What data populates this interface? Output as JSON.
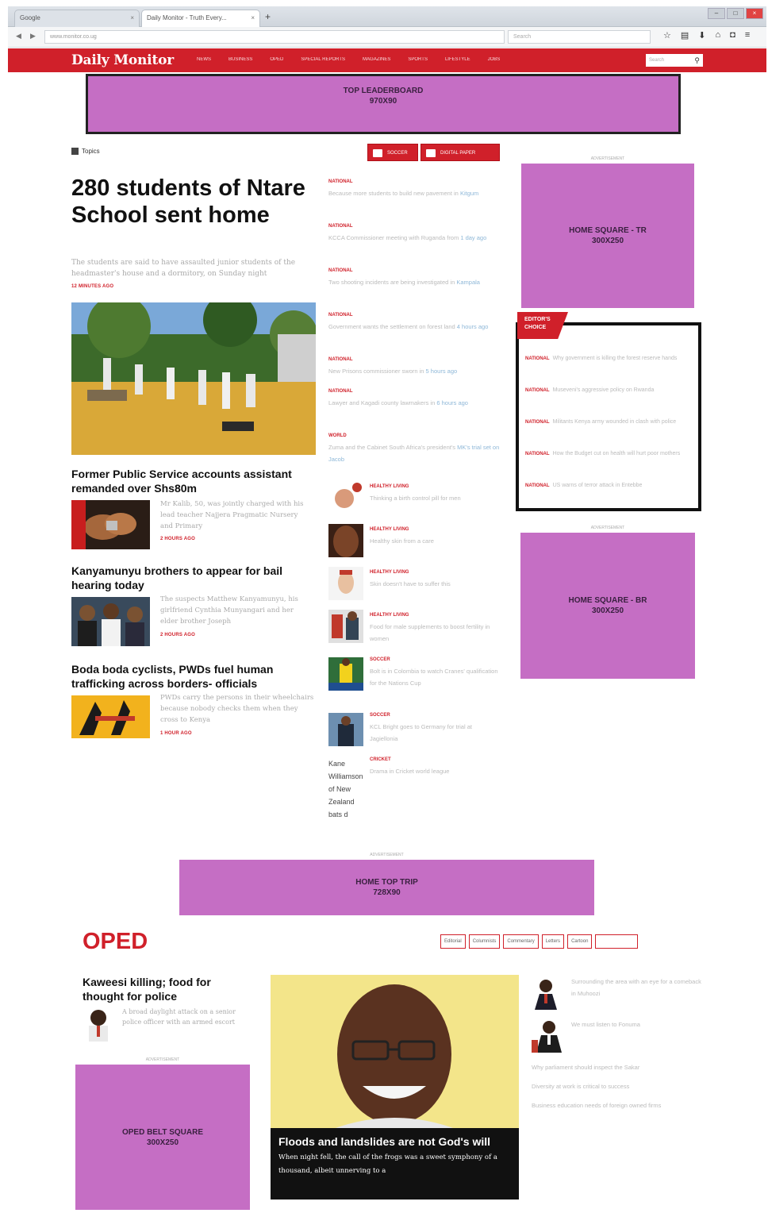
{
  "browser": {
    "tabs": [
      {
        "label": "Google"
      },
      {
        "label": "Daily Monitor - Truth Every..."
      }
    ],
    "url": "www.monitor.co.ug",
    "search_placeholder": "Search"
  },
  "site": {
    "logo": "Daily Monitor",
    "menu": [
      "NEWS",
      "BUSINESS",
      "OPED",
      "SPECIAL REPORTS",
      "MAGAZINES",
      "SPORTS",
      "LIFESTYLE",
      "JOBS"
    ],
    "search_placeholder": "Search"
  },
  "ads": {
    "leaderboard": [
      "TOP LEADERBOARD",
      "970X90"
    ],
    "tr": [
      "HOME SQUARE - TR",
      "300X250"
    ],
    "br": [
      "HOME SQUARE - BR",
      "300X250"
    ],
    "strip": [
      "HOME TOP TRIP",
      "728X90"
    ],
    "oped": [
      "OPED BELT SQUARE",
      "300X250"
    ],
    "label": "ADVERTISEMENT"
  },
  "topics": "Topics",
  "buttons": {
    "soccer": "SOCCER",
    "epaper": "DIGITAL PAPER"
  },
  "lead": {
    "title": "280 students of Ntare School sent home",
    "desc": "The students are said to have assaulted junior students of the headmaster's house and a dormitory, on Sunday night",
    "time": "12 MINUTES AGO"
  },
  "stories": [
    {
      "title": "Former Public Service accounts assistant remanded over Shs80m",
      "desc": "Mr Kalib, 50, was jointly charged with his lead teacher Najjera Pragmatic Nursery and Primary",
      "time": "2 HOURS AGO"
    },
    {
      "title": "Kanyamunyu brothers to appear for bail hearing today",
      "desc": "The suspects Matthew Kanyamunyu, his girlfriend Cynthia Munyangari and her elder brother Joseph",
      "time": "2 HOURS AGO"
    },
    {
      "title": "Boda boda cyclists, PWDs fuel human trafficking across borders- officials",
      "desc": "PWDs carry the persons in their wheelchairs because nobody checks them when they cross to Kenya",
      "time": "1 HOUR AGO"
    }
  ],
  "middle": [
    {
      "cat": "NATIONAL",
      "text": "Because more students to build new pavement in",
      "ago": "Kitgum"
    },
    {
      "cat": "NATIONAL",
      "text": "KCCA Commissioner meeting with Ruganda from",
      "ago": "1 day ago"
    },
    {
      "cat": "NATIONAL",
      "text": "Two shooting incidents are being investigated in",
      "ago": "Kampala"
    },
    {
      "cat": "NATIONAL",
      "text": "Government wants the settlement on forest land",
      "ago": "4 hours ago"
    },
    {
      "cat": "NATIONAL",
      "text": "New Prisons commissioner sworn in",
      "ago": "5 hours ago"
    },
    {
      "cat": "NATIONAL",
      "text": "Lawyer and Kagadi county lawmakers in",
      "ago": "6 hours ago"
    },
    {
      "cat": "WORLD",
      "text": "Zuma and the Cabinet South Africa's president's",
      "ago": "MK's trial set on Jacob"
    }
  ],
  "healthy": [
    {
      "cat": "HEALTHY LIVING",
      "text": "Thinking a birth control pill for men"
    },
    {
      "cat": "HEALTHY LIVING",
      "text": "Healthy skin from a care"
    },
    {
      "cat": "HEALTHY LIVING",
      "text": "Skin doesn't have to suffer this"
    },
    {
      "cat": "HEALTHY LIVING",
      "text": "Food for male supplements to boost fertility in women"
    },
    {
      "cat": "SOCCER",
      "text": "Bolt is in Colombia to watch Cranes' qualification for the Nations Cup"
    },
    {
      "cat": "SOCCER",
      "text": "KCL Bright goes to Germany for trial at Jagiellonia"
    },
    {
      "cat": "CRICKET",
      "text": "Drama in Cricket world league"
    }
  ],
  "kane": "Kane Williamson of New Zealand bats d",
  "editors_choice": {
    "badge": "EDITOR'S CHOICE",
    "items": [
      {
        "cat": "NATIONAL",
        "text": "Why government is killing the forest reserve hands"
      },
      {
        "cat": "NATIONAL",
        "text": "Museveni's aggressive policy on Rwanda"
      },
      {
        "cat": "NATIONAL",
        "text": "Militants Kenya army wounded in clash with police"
      },
      {
        "cat": "NATIONAL",
        "text": "How the Budget cut on health will hurt poor mothers"
      },
      {
        "cat": "NATIONAL",
        "text": "US warns of terror attack in Entebbe"
      }
    ]
  },
  "oped": {
    "title": "OPED",
    "tabs": [
      "Editorial",
      "Columnists",
      "Commentary",
      "Letters",
      "Cartoon",
      ""
    ],
    "kaweesi": {
      "title": "Kaweesi killing; food for thought for police",
      "desc": "A broad daylight attack on a senior police officer with an armed escort"
    },
    "feature": {
      "title": "Floods and landslides are not God's will",
      "desc": "When night fell, the call of the frogs was a sweet symphony of a thousand, albeit unnerving to a"
    },
    "right": [
      "Surrounding the area with an eye for a comeback in Muhoozi",
      "We must listen to Fonuma",
      "Why parliament should inspect the Sakar",
      "Diversity at work is critical to success",
      "Business education needs of foreign owned firms"
    ]
  }
}
